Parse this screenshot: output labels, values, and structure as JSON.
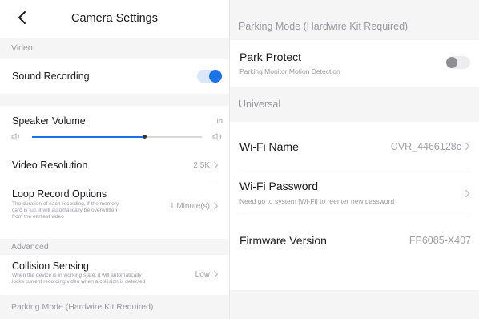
{
  "header": {
    "title": "Camera Settings"
  },
  "colors": {
    "accent": "#1a73e8",
    "section_bg": "#f5f5f6",
    "muted": "#9a9aa0"
  },
  "left": {
    "section_video": "Video",
    "sound_recording": {
      "label": "Sound Recording",
      "enabled": true
    },
    "speaker_volume": {
      "label": "Speaker Volume",
      "level_fraction": 0.66,
      "end_label": "in"
    },
    "video_resolution": {
      "label": "Video Resolution",
      "value": "2.5K"
    },
    "loop_record": {
      "label": "Loop Record Options",
      "desc_1": "The duration of each recording, if the memory",
      "desc_2": "card is full, it will automatically be overwritten",
      "desc_3": "from the earliest video",
      "value": "1 Minute(s)"
    },
    "section_advanced": "Advanced",
    "collision_sensing": {
      "label": "Collision Sensing",
      "desc_1": "When the device is in working state, it will automatically",
      "desc_2": "locks current recording video when a collision is detected",
      "value": "Low"
    },
    "section_parking": "Parking Mode (Hardwire Kit Required)"
  },
  "right": {
    "section_parking": "Parking Mode (Hardwire Kit Required)",
    "park_protect": {
      "label": "Park Protect",
      "desc": "Parking Monitor Motion Detection",
      "enabled": false
    },
    "section_universal": "Universal",
    "wifi_name": {
      "label": "Wi-Fi Name",
      "value": "CVR_4466128c"
    },
    "wifi_password": {
      "label": "Wi-Fi Password",
      "desc": "Need go to system [Wi-Fi] to reenter new password"
    },
    "firmware": {
      "label": "Firmware Version",
      "value": "FP6085-X407"
    }
  }
}
